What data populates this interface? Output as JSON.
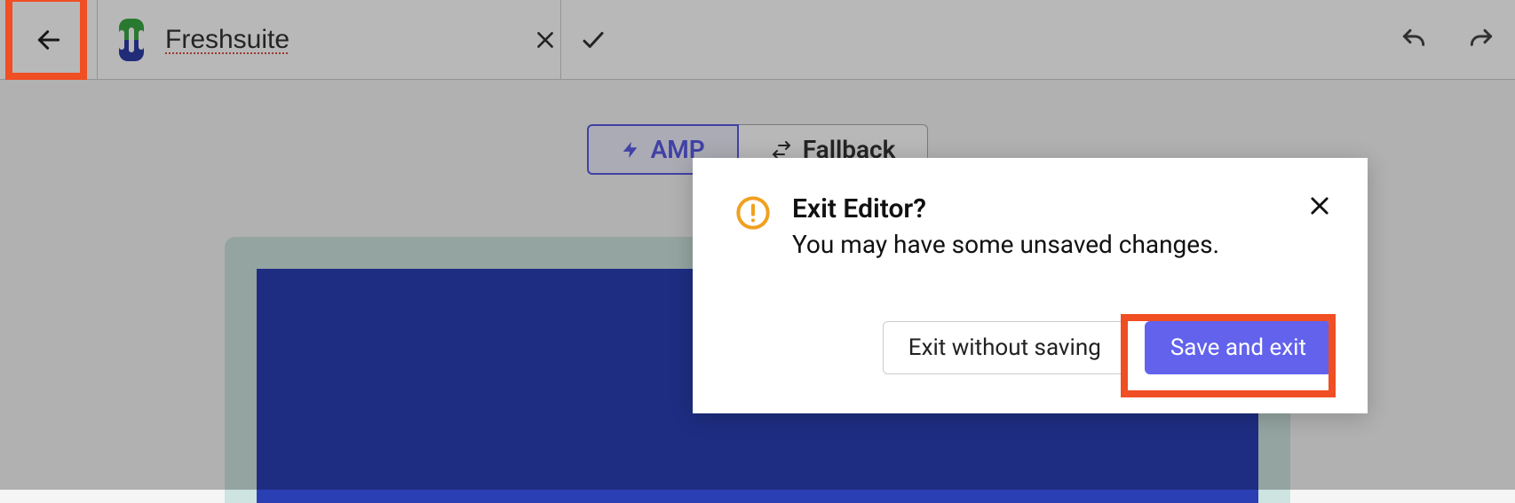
{
  "header": {
    "title_value": "Freshsuite"
  },
  "tabs": {
    "amp_label": "AMP",
    "fallback_label": "Fallback"
  },
  "modal": {
    "title": "Exit Editor?",
    "body": "You may have some unsaved changes.",
    "secondary_label": "Exit without saving",
    "primary_label": "Save and exit"
  }
}
